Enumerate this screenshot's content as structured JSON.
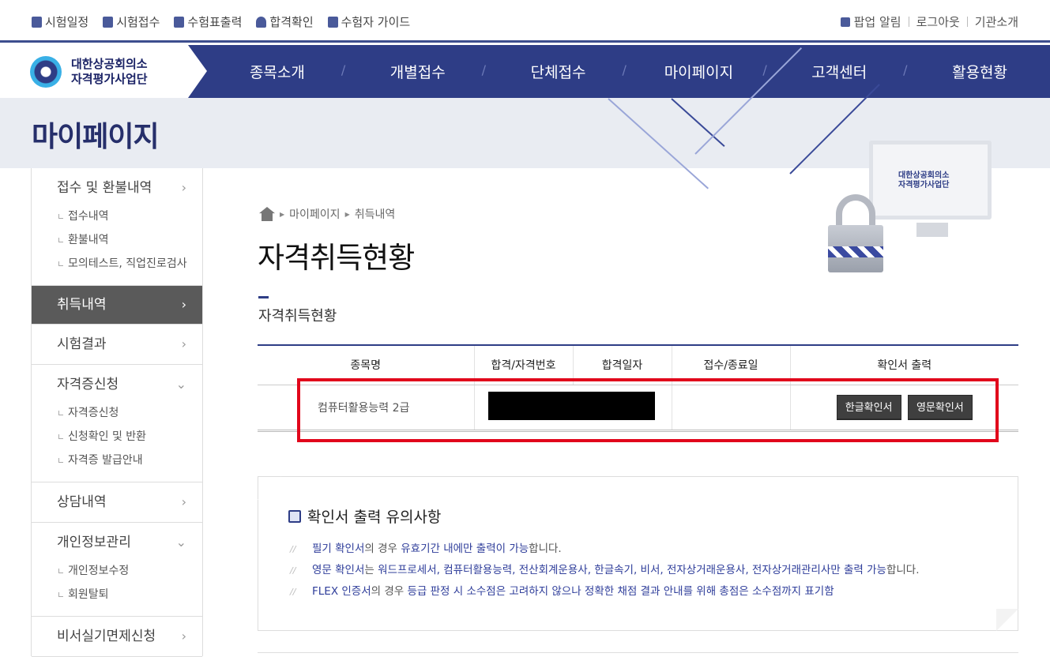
{
  "topbar": {
    "left": [
      {
        "label": "시험일정",
        "icon": "calendar-icon"
      },
      {
        "label": "시험접수",
        "icon": "pencil-icon"
      },
      {
        "label": "수험표출력",
        "icon": "printer-icon"
      },
      {
        "label": "합격확인",
        "icon": "award-icon"
      },
      {
        "label": "수험자 가이드",
        "icon": "book-icon"
      }
    ],
    "right": [
      {
        "label": "팝업 알림",
        "icon": "popup-icon"
      },
      {
        "label": "로그아웃"
      },
      {
        "label": "기관소개"
      }
    ]
  },
  "logo": {
    "line1": "대한상공회의소",
    "line2": "자격평가사업단"
  },
  "gnb": [
    "종목소개",
    "개별접수",
    "단체접수",
    "마이페이지",
    "고객센터",
    "활용현황"
  ],
  "visual": {
    "title": "마이페이지"
  },
  "monitor_logo": {
    "line1": "대한상공회의소",
    "line2": "자격평가사업단"
  },
  "lnb": [
    {
      "label": "접수 및 환불내역",
      "arrow": "›",
      "subs": [
        "접수내역",
        "환불내역",
        "모의테스트, 직업진로검사"
      ]
    },
    {
      "label": "취득내역",
      "arrow": "›",
      "active": true,
      "subs": []
    },
    {
      "label": "시험결과",
      "arrow": "›",
      "subs": []
    },
    {
      "label": "자격증신청",
      "arrow": "⌄",
      "subs": [
        "자격증신청",
        "신청확인 및 반환",
        "자격증 발급안내"
      ]
    },
    {
      "label": "상담내역",
      "arrow": "›",
      "subs": []
    },
    {
      "label": "개인정보관리",
      "arrow": "⌄",
      "subs": [
        "개인정보수정",
        "회원탈퇴"
      ]
    },
    {
      "label": "비서실기면제신청",
      "arrow": "›",
      "subs": []
    }
  ],
  "breadcrumb": [
    "마이페이지",
    "취득내역"
  ],
  "page_title": "자격취득현황",
  "section_title": "자격취득현황",
  "table": {
    "headers": [
      "종목명",
      "합격/자격번호",
      "합격일자",
      "접수/종료일",
      "확인서 출력"
    ],
    "rows": [
      {
        "subject": "컴퓨터활용능력 2급",
        "number": "",
        "date": "",
        "period": "",
        "buttons": [
          "한글확인서",
          "영문확인서"
        ]
      }
    ]
  },
  "notice": {
    "title": "확인서 출력 유의사항",
    "items": [
      [
        {
          "t": "필기 확인서",
          "c": "b"
        },
        {
          "t": "의 경우 ",
          "c": "g"
        },
        {
          "t": "유효기간 내에만 출력이 가능",
          "c": "b"
        },
        {
          "t": "합니다.",
          "c": "g"
        }
      ],
      [
        {
          "t": "영문 확인서",
          "c": "b"
        },
        {
          "t": "는 ",
          "c": "g"
        },
        {
          "t": "워드프로세서, 컴퓨터활용능력, 전산회계운용사, 한글속기, 비서, 전자상거래운용사, 전자상거래관리사만 출력 가능",
          "c": "b"
        },
        {
          "t": "합니다.",
          "c": "g"
        }
      ],
      [
        {
          "t": "FLEX 인증서",
          "c": "b"
        },
        {
          "t": "의 경우 ",
          "c": "g"
        },
        {
          "t": "등급 판정 시 소수점은 고려하지 않으나 정확한 채점 결과 안내를 위해 총점은 소수점까지 표기함",
          "c": "b"
        }
      ]
    ]
  },
  "colors": {
    "brand": "#2e3d86",
    "highlight": "#e1061b",
    "active_nav": "#5a5a5a"
  }
}
